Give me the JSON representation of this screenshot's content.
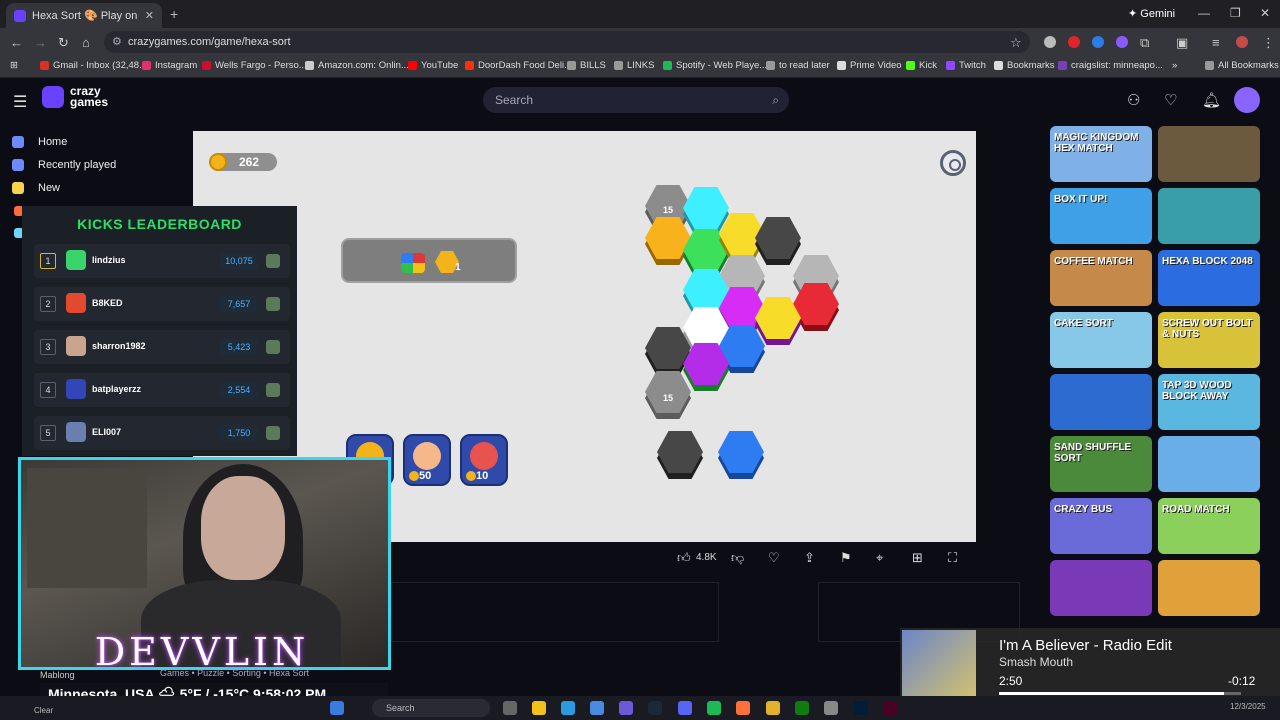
{
  "browser": {
    "tab_title": "Hexa Sort 🎨 Play on Crazy...",
    "gemini": "Gemini",
    "url": "crazygames.com/game/hexa-sort"
  },
  "bookmarks": [
    {
      "label": "Gmail - Inbox (32,48...",
      "color": "#d93025"
    },
    {
      "label": "Instagram",
      "color": "#e1306c"
    },
    {
      "label": "Wells Fargo - Perso...",
      "color": "#c8102e"
    },
    {
      "label": "Amazon.com: Onlin...",
      "color": "#cccccc"
    },
    {
      "label": "YouTube",
      "color": "#ff0000"
    },
    {
      "label": "DoorDash Food Deli...",
      "color": "#ff3008"
    },
    {
      "label": "BILLS",
      "color": "#999999"
    },
    {
      "label": "LINKS",
      "color": "#999999"
    },
    {
      "label": "Spotify - Web Playe...",
      "color": "#1db954"
    },
    {
      "label": "to read later",
      "color": "#999999"
    },
    {
      "label": "Prime Video",
      "color": "#dddddd"
    },
    {
      "label": "Kick",
      "color": "#53fc18"
    },
    {
      "label": "Twitch",
      "color": "#9146ff"
    },
    {
      "label": "Bookmarks",
      "color": "#dddddd"
    },
    {
      "label": "craigslist: minneapo...",
      "color": "#7a3fb7"
    },
    {
      "label": "All Bookmarks",
      "color": "#999999"
    }
  ],
  "header": {
    "logo_text": "crazy games",
    "search_placeholder": "Search"
  },
  "sidebar": {
    "items": [
      {
        "label": "Home",
        "color": "#6d8bff"
      },
      {
        "label": "Recently played",
        "color": "#6d8bff"
      },
      {
        "label": "New",
        "color": "#f6d34a"
      }
    ]
  },
  "game": {
    "coins": "262",
    "booster_count": "1",
    "lock_level": "15",
    "boosters": [
      {
        "label": "",
        "color": "#f2b41a"
      },
      {
        "label": "50",
        "color": "#f6b78a"
      },
      {
        "label": "10",
        "color": "#e8534f"
      }
    ]
  },
  "actions": {
    "likes": "4.8K"
  },
  "leaderboard": {
    "title": "KICKS LEADERBOARD",
    "rows": [
      {
        "rank": "1",
        "name": "lindzius",
        "score": "10,075",
        "avatar": "#3bd46a"
      },
      {
        "rank": "2",
        "name": "B8KED",
        "score": "7,657",
        "avatar": "#e2492f"
      },
      {
        "rank": "3",
        "name": "sharron1982",
        "score": "5,423",
        "avatar": "#caa48d"
      },
      {
        "rank": "4",
        "name": "batplayerzz",
        "score": "2,554",
        "avatar": "#3346b8"
      },
      {
        "rank": "5",
        "name": "ELI007",
        "score": "1,750",
        "avatar": "#6a7fb0"
      }
    ]
  },
  "stream": {
    "name": "DEVVLIN",
    "categories": "Games • Puzzle • Sorting • Hexa Sort",
    "caption": "Mablong",
    "weather": "Minnesota, USA 🌧 5°F / -15°C 9:58:02 PM"
  },
  "now_playing": {
    "song": "I'm A Believer - Radio Edit",
    "artist": "Smash Mouth",
    "elapsed": "2:50",
    "remaining": "-0:12",
    "progress": 0.93
  },
  "thumbnails": [
    {
      "label": "MAGIC KINGDOM HEX MATCH",
      "color": "#7fb0e8"
    },
    {
      "label": "",
      "color": "#6b5a3d"
    },
    {
      "label": "BOX IT UP!",
      "color": "#3fa0e8"
    },
    {
      "label": "",
      "color": "#3a9ea8"
    },
    {
      "label": "COFFEE MATCH",
      "color": "#c58a4a"
    },
    {
      "label": "HEXA BLOCK 2048",
      "color": "#2b6de0"
    },
    {
      "label": "CAKE SORT",
      "color": "#87c7e8"
    },
    {
      "label": "SCREW OUT BOLT & NUTS",
      "color": "#d8c23a"
    },
    {
      "label": "",
      "color": "#2e6bd0"
    },
    {
      "label": "TAP 3D WOOD BLOCK AWAY",
      "color": "#5ab8e0"
    },
    {
      "label": "SAND SHUFFLE SORT",
      "color": "#4a8a3a"
    },
    {
      "label": "",
      "color": "#6aaee8"
    },
    {
      "label": "CRAZY BUS",
      "color": "#6a6ad8"
    },
    {
      "label": "ROAD MATCH",
      "color": "#8ad05a"
    },
    {
      "label": "",
      "color": "#7a3ab8"
    },
    {
      "label": "",
      "color": "#e0a03a"
    }
  ],
  "taskbar": {
    "search": "Search",
    "date": "12/3/2025",
    "weather": "Clear"
  }
}
